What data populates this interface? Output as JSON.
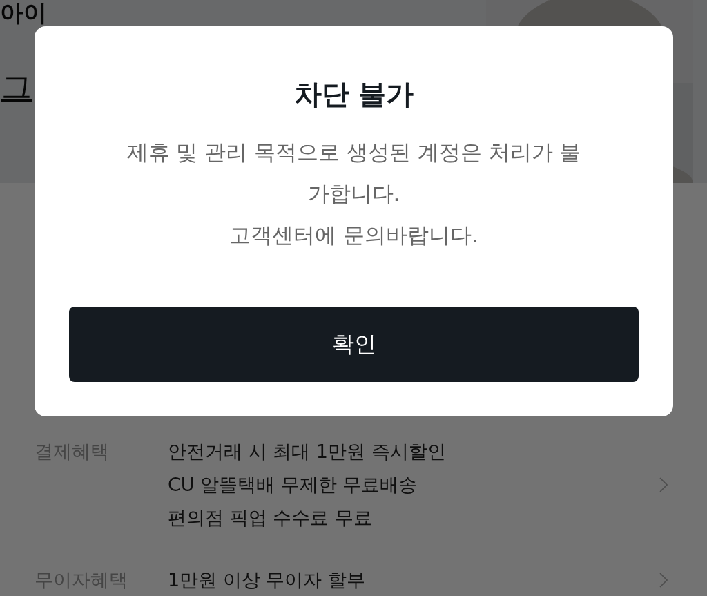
{
  "background": {
    "heading": "아이",
    "link_fragment": "그",
    "benefits": [
      {
        "label": "결제혜택",
        "lines": [
          "안전거래 시 최대 1만원 즉시할인",
          "CU 알뜰택배 무제한 무료배송",
          "편의점 픽업 수수료 무료"
        ]
      },
      {
        "label": "무이자혜택",
        "lines": [
          "1만원 이상 무이자 할부"
        ]
      }
    ]
  },
  "dialog": {
    "title": "차단 불가",
    "message": [
      "제휴 및 관리 목적으로 생성된 계정은 처리가 불가합니다.",
      "고객센터에 문의바랍니다."
    ],
    "button": "확인"
  }
}
